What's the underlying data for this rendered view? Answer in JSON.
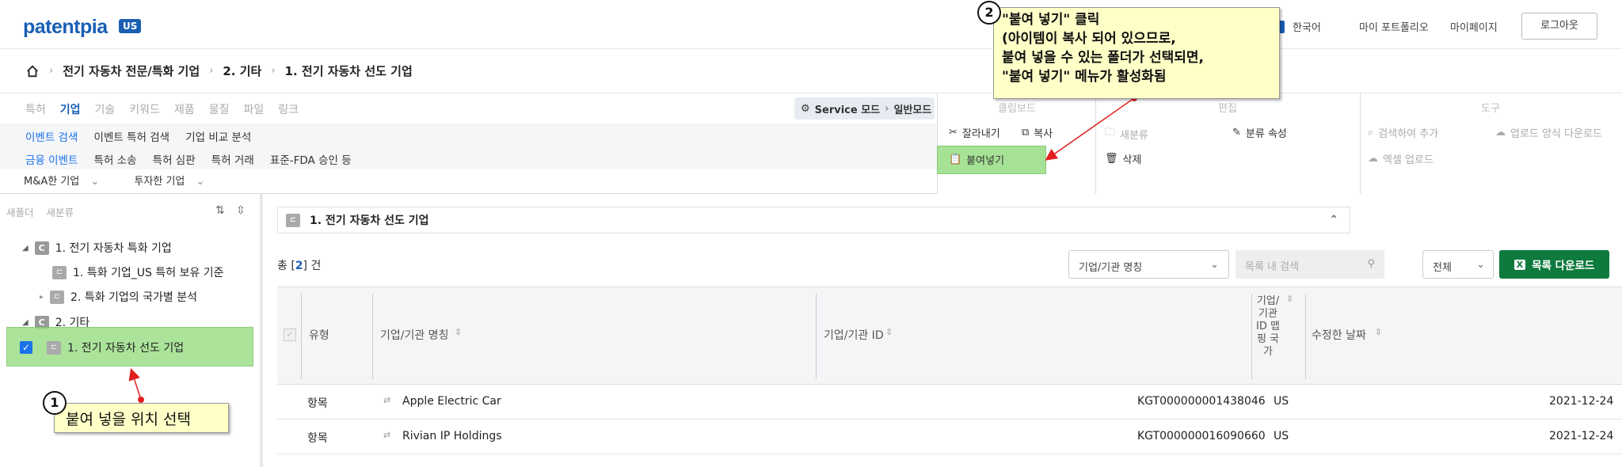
{
  "header": {
    "logo_text": "patentpia",
    "logo_badge": "US",
    "nav": [
      "한국어",
      "마이 포트폴리오",
      "마이페이지"
    ],
    "logout": "로그아웃"
  },
  "breadcrumb": [
    "전기 자동차 전문/특화 기업",
    "2. 기타",
    "1. 전기 자동차 선도 기업"
  ],
  "tabs": [
    "특허",
    "기업",
    "기술",
    "키워드",
    "제품",
    "물질",
    "파일",
    "링크"
  ],
  "active_tab": "기업",
  "subrow1": [
    "이벤트 검색",
    "이벤트 특허 검색",
    "기업 비교 분석"
  ],
  "subrow2": [
    "금융 이벤트",
    "특허 소송",
    "특허 심판",
    "특허 거래",
    "표준-FDA 승인 등"
  ],
  "subrow3": [
    "M&A한 기업",
    "투자한 기업"
  ],
  "service_mode": {
    "label": "Service 모드",
    "current": "일반모드"
  },
  "toolbar": {
    "clipboard_title": "클립보드",
    "cut": "잘라내기",
    "copy": "복사",
    "paste": "붙여넣기",
    "edit_title": "편집",
    "new_category": "새분류",
    "category_props": "분류 속성",
    "delete": "삭제",
    "tools_title": "도구",
    "search_add": "검색하여 추가",
    "upload_form_download": "업로드 양식 다운로드",
    "excel_upload": "엑셀 업로드"
  },
  "left_panel": {
    "new_folder": "새폴더",
    "new_category": "새분류",
    "tree": [
      {
        "tag": "C",
        "label": "1. 전기 자동차 특화 기업",
        "level": 0
      },
      {
        "tag": "E",
        "label": "1. 특화 기업_US 특허 보유 기준",
        "level": 1
      },
      {
        "tag": "E",
        "label": "2. 특화 기업의 국가별 분석",
        "level": 1
      },
      {
        "tag": "C",
        "label": "2. 기타",
        "level": 0
      },
      {
        "tag": "E",
        "label": "1. 전기 자동차 선도 기업",
        "level": 1
      }
    ]
  },
  "main": {
    "folder_title": "1. 전기 자동차 선도 기업",
    "count_prefix": "총 [",
    "count": "2",
    "count_suffix": "] 건",
    "filter_select": "기업/기관 명칭",
    "search_placeholder": "목록 내 검색",
    "scope_select": "전체",
    "download_btn": "목록 다운로드",
    "columns": [
      "유형",
      "기업/기관 명칭",
      "기업/기관 ID",
      "기업/기관 ID 맵핑 국가",
      "수정한 날짜"
    ],
    "rows": [
      {
        "type": "항목",
        "name": "Apple Electric Car",
        "id": "KGT000000001438046",
        "country": "US",
        "date": "2021-12-24"
      },
      {
        "type": "항목",
        "name": "Rivian IP Holdings",
        "id": "KGT000000016090660",
        "country": "US",
        "date": "2021-12-24"
      }
    ]
  },
  "callouts": {
    "c1_num": "1",
    "c1_text": "붙여 넣을 위치 선택",
    "c2_num": "2",
    "c2_lines": [
      "\"붙여 넣기\" 클릭",
      "(아이템이 복사 되어 있으므로,",
      "붙여 넣을 수 있는 폴더가 선택되면,",
      "\"붙여 넣기\" 메뉴가 활성화됨"
    ]
  },
  "colors": {
    "brand": "#1a5fb4",
    "highlight": "#9ddf8a",
    "callout_bg": "#ffffc8",
    "download_btn": "#0e7a3d"
  }
}
